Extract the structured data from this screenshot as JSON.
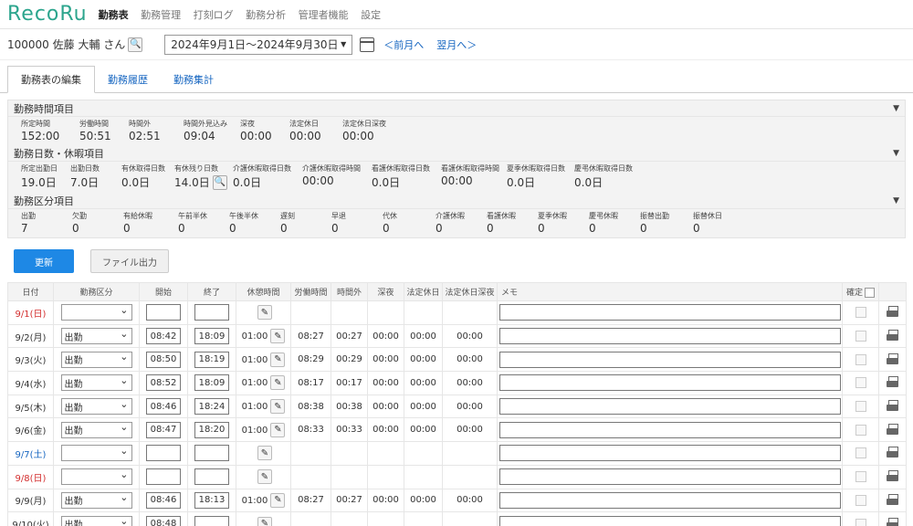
{
  "app": {
    "logo": "RecoRu"
  },
  "nav": [
    "勤務表",
    "勤務管理",
    "打刻ログ",
    "勤務分析",
    "管理者機能",
    "設定"
  ],
  "user": {
    "label": "100000 佐藤 大輔 さん"
  },
  "period": {
    "value": "2024年9月1日～2024年9月30日",
    "prev": "＜前月へ",
    "next": "翌月へ＞"
  },
  "tabs": [
    "勤務表の編集",
    "勤務履歴",
    "勤務集計"
  ],
  "sections": {
    "time": {
      "title": "勤務時間項目",
      "items": [
        {
          "k": "所定時間",
          "v": "152:00"
        },
        {
          "k": "労働時間",
          "v": "50:51"
        },
        {
          "k": "時間外",
          "v": "02:51"
        },
        {
          "k": "時間外見込み",
          "v": "09:04"
        },
        {
          "k": "深夜",
          "v": "00:00"
        },
        {
          "k": "法定休日",
          "v": "00:00"
        },
        {
          "k": "法定休日深夜",
          "v": "00:00"
        }
      ]
    },
    "days": {
      "title": "勤務日数・休暇項目",
      "items": [
        {
          "k": "所定出勤日",
          "v": "19.0日"
        },
        {
          "k": "出勤日数",
          "v": "7.0日"
        },
        {
          "k": "有休取得日数",
          "v": "0.0日"
        },
        {
          "k": "有休残り日数",
          "v": "14.0日"
        },
        {
          "k": "介護休暇取得日数",
          "v": "0.0日"
        },
        {
          "k": "介護休暇取得時間",
          "v": "00:00"
        },
        {
          "k": "看護休暇取得日数",
          "v": "0.0日"
        },
        {
          "k": "看護休暇取得時間",
          "v": "00:00"
        },
        {
          "k": "夏季休暇取得日数",
          "v": "0.0日"
        },
        {
          "k": "慶弔休暇取得日数",
          "v": "0.0日"
        }
      ]
    },
    "kubun": {
      "title": "勤務区分項目",
      "items": [
        {
          "k": "出勤",
          "v": "7"
        },
        {
          "k": "欠勤",
          "v": "0"
        },
        {
          "k": "有給休暇",
          "v": "0"
        },
        {
          "k": "午前半休",
          "v": "0"
        },
        {
          "k": "午後半休",
          "v": "0"
        },
        {
          "k": "遅刻",
          "v": "0"
        },
        {
          "k": "早退",
          "v": "0"
        },
        {
          "k": "代休",
          "v": "0"
        },
        {
          "k": "介護休暇",
          "v": "0"
        },
        {
          "k": "看護休暇",
          "v": "0"
        },
        {
          "k": "夏季休暇",
          "v": "0"
        },
        {
          "k": "慶弔休暇",
          "v": "0"
        },
        {
          "k": "振替出勤",
          "v": "0"
        },
        {
          "k": "振替休日",
          "v": "0"
        }
      ]
    }
  },
  "actions": {
    "update": "更新",
    "export": "ファイル出力"
  },
  "table": {
    "headers": [
      "日付",
      "勤務区分",
      "開始",
      "終了",
      "休憩時間",
      "労働時間",
      "時間外",
      "深夜",
      "法定休日",
      "法定休日深夜",
      "メモ",
      "確定",
      ""
    ],
    "rows": [
      {
        "date": "9/1(日)",
        "day": "sun",
        "kubun": "",
        "start": "",
        "end": "",
        "rest": "",
        "work": "",
        "over": "",
        "night": "",
        "hol": "",
        "holnight": ""
      },
      {
        "date": "9/2(月)",
        "day": "wk",
        "kubun": "出勤",
        "start": "08:42",
        "end": "18:09",
        "rest": "01:00",
        "work": "08:27",
        "over": "00:27",
        "night": "00:00",
        "hol": "00:00",
        "holnight": "00:00"
      },
      {
        "date": "9/3(火)",
        "day": "wk",
        "kubun": "出勤",
        "start": "08:50",
        "end": "18:19",
        "rest": "01:00",
        "work": "08:29",
        "over": "00:29",
        "night": "00:00",
        "hol": "00:00",
        "holnight": "00:00"
      },
      {
        "date": "9/4(水)",
        "day": "wk",
        "kubun": "出勤",
        "start": "08:52",
        "end": "18:09",
        "rest": "01:00",
        "work": "08:17",
        "over": "00:17",
        "night": "00:00",
        "hol": "00:00",
        "holnight": "00:00"
      },
      {
        "date": "9/5(木)",
        "day": "wk",
        "kubun": "出勤",
        "start": "08:46",
        "end": "18:24",
        "rest": "01:00",
        "work": "08:38",
        "over": "00:38",
        "night": "00:00",
        "hol": "00:00",
        "holnight": "00:00"
      },
      {
        "date": "9/6(金)",
        "day": "wk",
        "kubun": "出勤",
        "start": "08:47",
        "end": "18:20",
        "rest": "01:00",
        "work": "08:33",
        "over": "00:33",
        "night": "00:00",
        "hol": "00:00",
        "holnight": "00:00"
      },
      {
        "date": "9/7(土)",
        "day": "sat",
        "kubun": "",
        "start": "",
        "end": "",
        "rest": "",
        "work": "",
        "over": "",
        "night": "",
        "hol": "",
        "holnight": ""
      },
      {
        "date": "9/8(日)",
        "day": "sun",
        "kubun": "",
        "start": "",
        "end": "",
        "rest": "",
        "work": "",
        "over": "",
        "night": "",
        "hol": "",
        "holnight": ""
      },
      {
        "date": "9/9(月)",
        "day": "wk",
        "kubun": "出勤",
        "start": "08:46",
        "end": "18:13",
        "rest": "01:00",
        "work": "08:27",
        "over": "00:27",
        "night": "00:00",
        "hol": "00:00",
        "holnight": "00:00"
      },
      {
        "date": "9/10(火)",
        "day": "wk",
        "kubun": "出勤",
        "start": "08:48",
        "end": "",
        "rest": "",
        "work": "",
        "over": "",
        "night": "",
        "hol": "",
        "holnight": ""
      }
    ]
  }
}
